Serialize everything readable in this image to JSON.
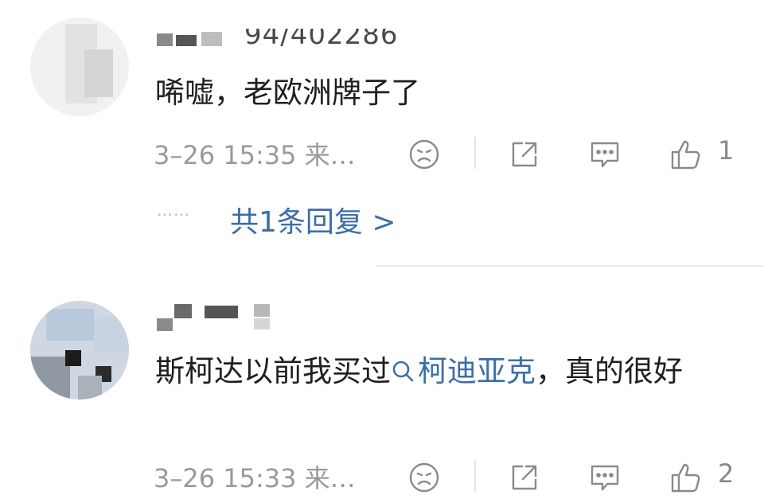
{
  "comments": [
    {
      "username_visible": "94/402286",
      "text": "唏嘘，老欧洲牌子了",
      "meta": "3–26 15:35 来…",
      "like_count": "1",
      "replies_label": "共1条回复 >",
      "replies_dots": "……"
    },
    {
      "username_visible": "",
      "text_before": "斯柯达以前我买过",
      "tag": "柯迪亚克",
      "text_after": "，真的很好",
      "meta": "3–26 15:33 来…",
      "like_count": "2"
    }
  ],
  "icons": {
    "reaction": "sad-face-icon",
    "share": "share-icon",
    "comment": "comment-icon",
    "like": "thumbs-up-icon",
    "tag_search": "search-icon"
  },
  "colors": {
    "link": "#3b6ea8",
    "meta_text": "#9a9a9a",
    "icon": "#8a8a8a"
  }
}
